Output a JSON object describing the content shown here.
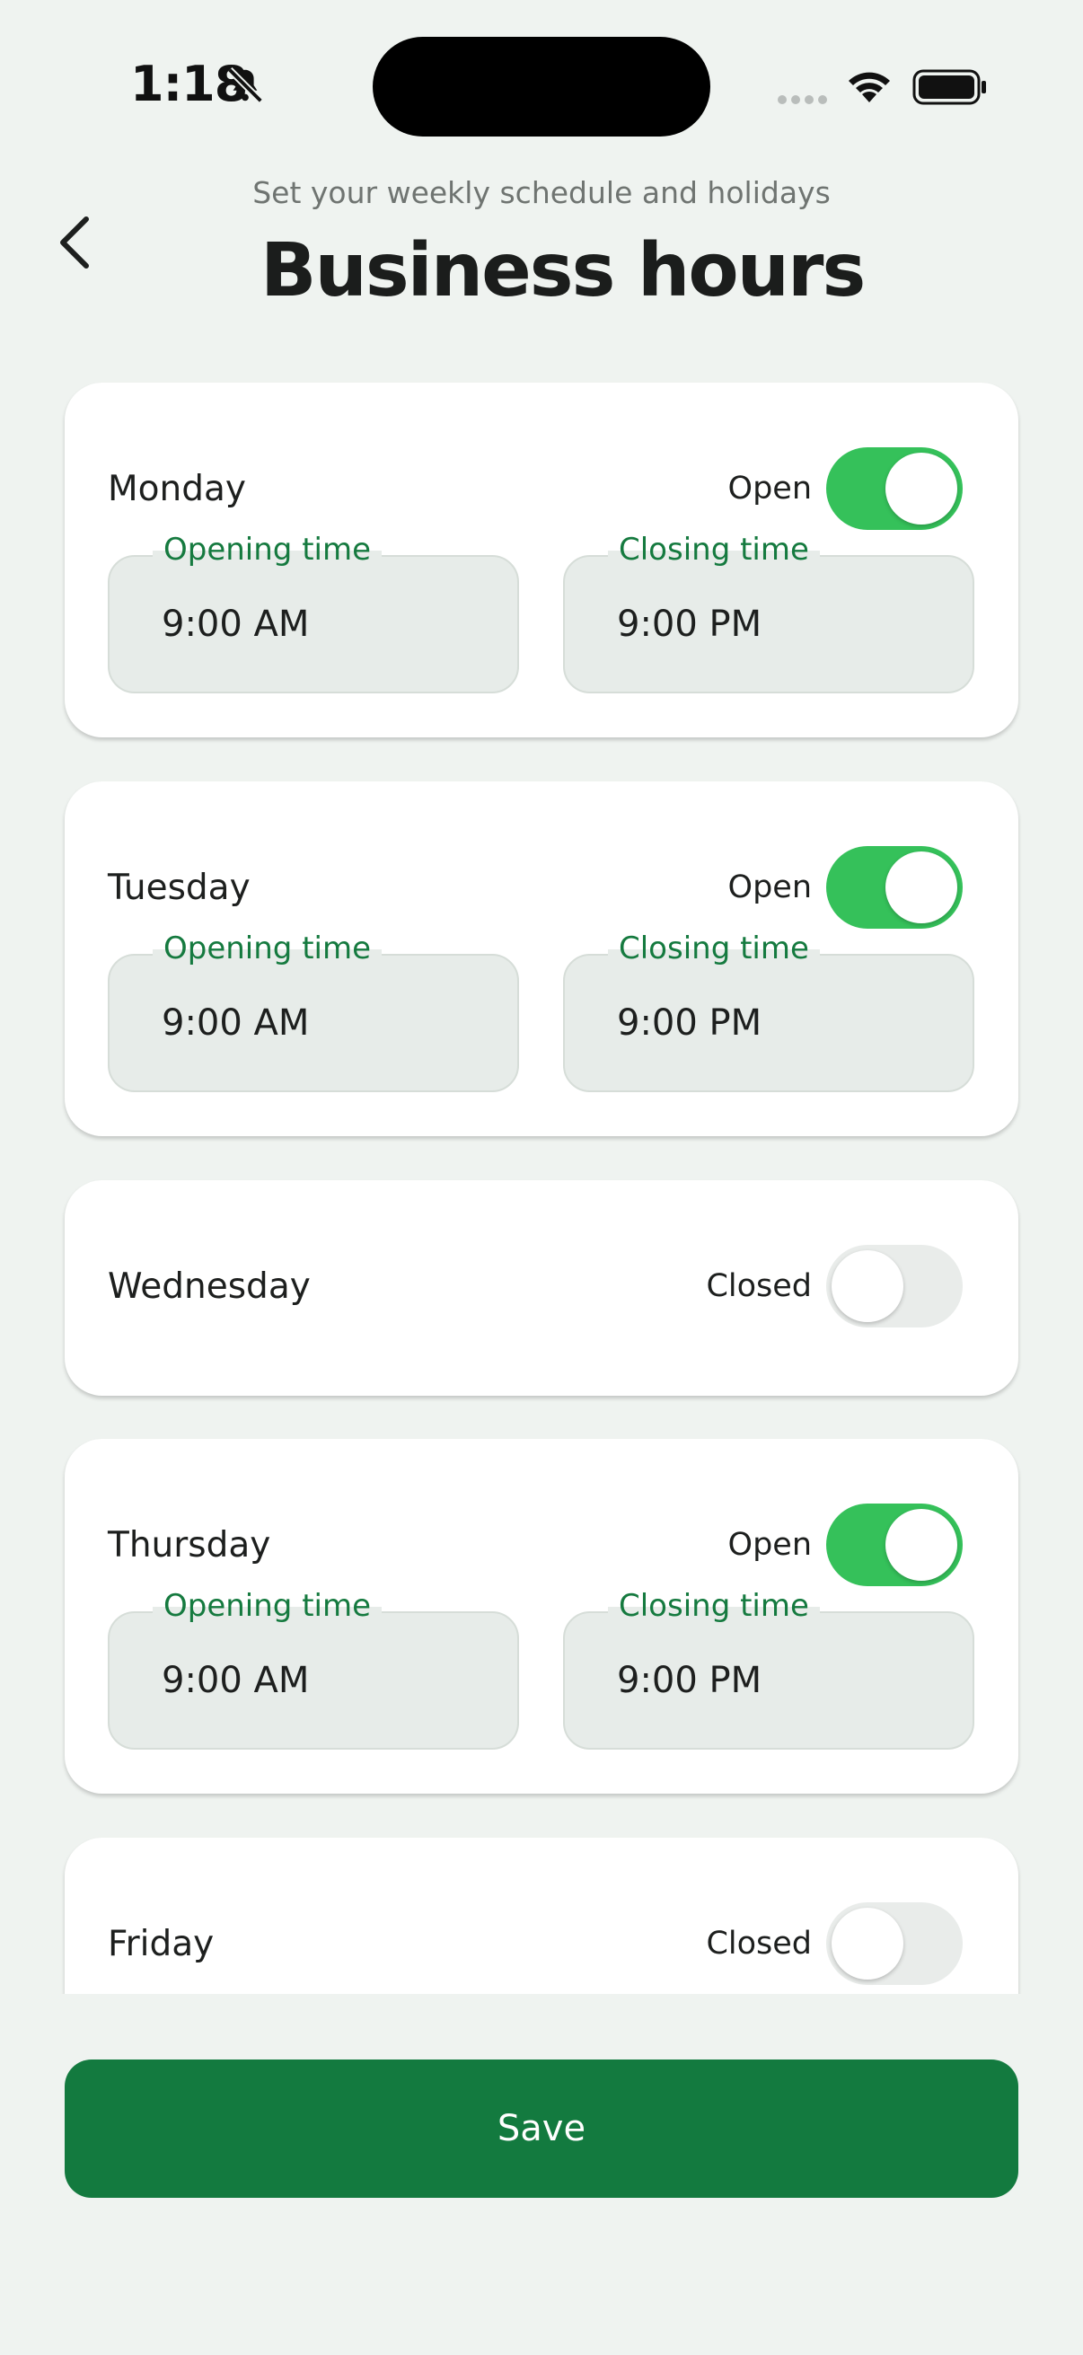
{
  "status_bar": {
    "time": "1:18"
  },
  "header": {
    "subtitle": "Set your weekly schedule and holidays",
    "title": "Business hours"
  },
  "days": [
    {
      "name": "Monday",
      "state": "Open",
      "open": true,
      "opening_label": "Opening time",
      "opening_time": "9:00 AM",
      "closing_label": "Closing time",
      "closing_time": "9:00 PM"
    },
    {
      "name": "Tuesday",
      "state": "Open",
      "open": true,
      "opening_label": "Opening time",
      "opening_time": "9:00 AM",
      "closing_label": "Closing time",
      "closing_time": "9:00 PM"
    },
    {
      "name": "Wednesday",
      "state": "Closed",
      "open": false
    },
    {
      "name": "Thursday",
      "state": "Open",
      "open": true,
      "opening_label": "Opening time",
      "opening_time": "9:00 AM",
      "closing_label": "Closing time",
      "closing_time": "9:00 PM"
    },
    {
      "name": "Friday",
      "state": "Closed",
      "open": false
    }
  ],
  "actions": {
    "save_label": "Save"
  },
  "colors": {
    "accent": "#137a3f",
    "toggle_on": "#35c15a",
    "label_green": "#157a3f",
    "background": "#eff3f0"
  },
  "icons": {
    "back": "chevron-left-icon",
    "silent": "bell-slash-icon",
    "wifi": "wifi-icon",
    "battery": "battery-icon"
  }
}
